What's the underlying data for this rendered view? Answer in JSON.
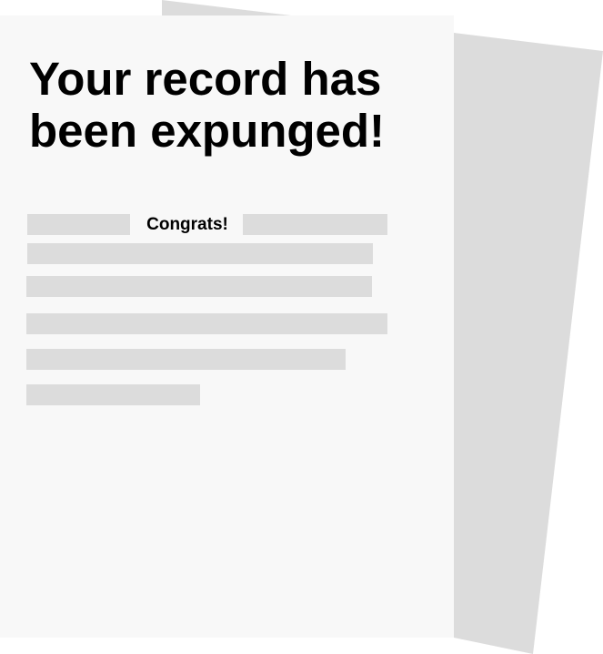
{
  "document": {
    "headline": "Your record has been expunged!",
    "highlight_text": "Congrats!"
  },
  "colors": {
    "back_sheet": "#dcdcdc",
    "front_sheet": "#f8f8f8",
    "placeholder_bar": "#dcdcdc",
    "text": "#000000"
  }
}
